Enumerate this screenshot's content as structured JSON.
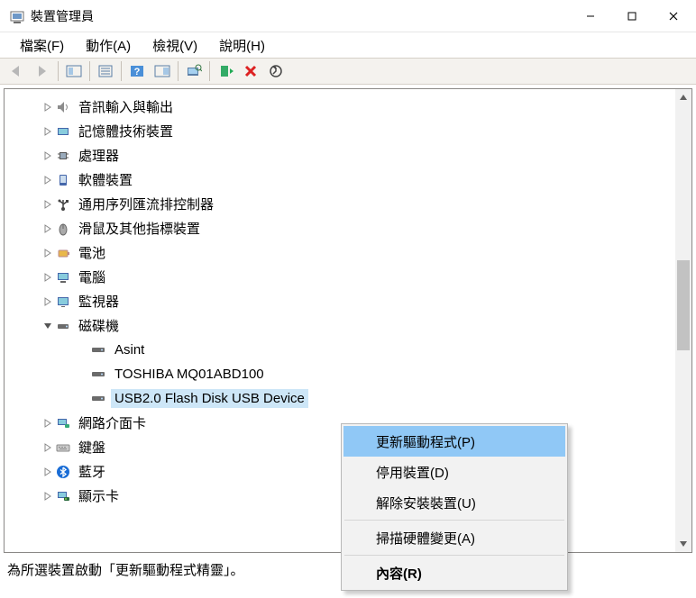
{
  "title": "裝置管理員",
  "menu": {
    "file": "檔案(F)",
    "action": "動作(A)",
    "view": "檢視(V)",
    "help": "說明(H)"
  },
  "tree": {
    "items": [
      {
        "label": "音訊輸入與輸出"
      },
      {
        "label": "記憶體技術裝置"
      },
      {
        "label": "處理器"
      },
      {
        "label": "軟體裝置"
      },
      {
        "label": "通用序列匯流排控制器"
      },
      {
        "label": "滑鼠及其他指標裝置"
      },
      {
        "label": "電池"
      },
      {
        "label": "電腦"
      },
      {
        "label": "監視器"
      },
      {
        "label": "磁碟機"
      },
      {
        "label": "網路介面卡"
      },
      {
        "label": "鍵盤"
      },
      {
        "label": "藍牙"
      },
      {
        "label": "顯示卡"
      }
    ],
    "disk_children": [
      {
        "label": "Asint"
      },
      {
        "label": "TOSHIBA MQ01ABD100"
      },
      {
        "label": "USB2.0 Flash Disk USB Device"
      }
    ]
  },
  "context": {
    "update": "更新驅動程式(P)",
    "disable": "停用裝置(D)",
    "uninstall": "解除安裝裝置(U)",
    "scan": "掃描硬體變更(A)",
    "properties": "內容(R)"
  },
  "status": "為所選裝置啟動「更新驅動程式精靈」。"
}
